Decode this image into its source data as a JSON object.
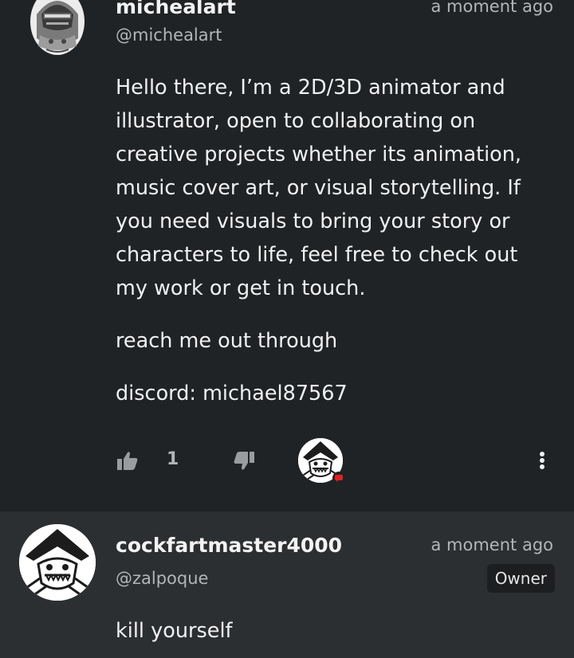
{
  "post": {
    "author": {
      "username": "michealart",
      "handle": "@michealart",
      "time": "a moment ago"
    },
    "paragraphs": [
      "Hello there, I’m a 2D/3D animator and illustrator, open to collaborating on creative projects whether its animation, music cover art, or visual storytelling. If you need visuals to bring your story or characters to life, feel free to check out my work or get in touch.",
      "reach me out through",
      "discord:  michael87567"
    ],
    "actions": {
      "like_count": "1",
      "like_icon": "thumbs-up-icon",
      "dislike_icon": "thumbs-down-icon",
      "reply_icon": "reply-avatar-icon",
      "more_icon": "more-vertical-icon",
      "reply_badge_color": "#e32020"
    }
  },
  "reply": {
    "author": {
      "username": "cockfartmaster4000",
      "handle": "@zalpoque",
      "time": "a moment ago",
      "badge": "Owner"
    },
    "text": "kill yourself"
  },
  "colors": {
    "background": "#202326",
    "reply_background": "#2c2f32",
    "muted_text": "#b3b5b7",
    "icon": "#9a9da0"
  }
}
